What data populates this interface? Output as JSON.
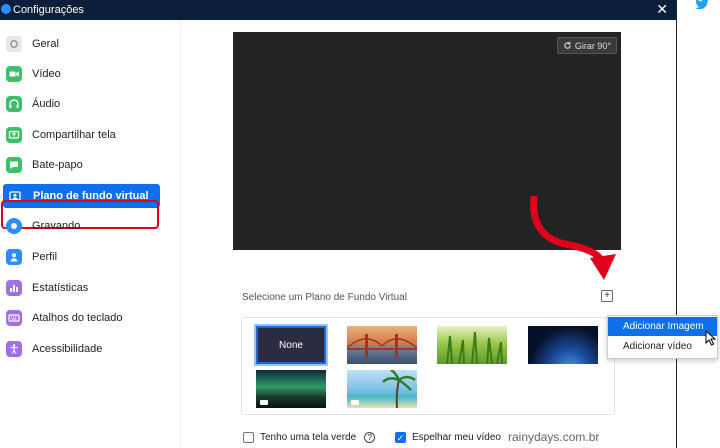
{
  "window": {
    "title": "Configurações",
    "close_glyph": "✕"
  },
  "right_pane": {
    "icon": "twitter-icon",
    "glyph": "🐦"
  },
  "sidebar": {
    "items": [
      {
        "label": "Geral",
        "icon": "gear-icon",
        "color": "#d0d0d0"
      },
      {
        "label": "Vídeo",
        "icon": "video-icon",
        "color": "#3cc06a"
      },
      {
        "label": "Áudio",
        "icon": "headphones-icon",
        "color": "#3cc06a"
      },
      {
        "label": "Compartilhar tela",
        "icon": "share-screen-icon",
        "color": "#3cc06a"
      },
      {
        "label": "Bate-papo",
        "icon": "chat-icon",
        "color": "#3cc06a"
      },
      {
        "label": "Plano de fundo virtual",
        "icon": "virtual-background-icon",
        "color": "#ffffff"
      },
      {
        "label": "Gravando",
        "icon": "record-icon",
        "color": "#2d8cff"
      },
      {
        "label": "Perfil",
        "icon": "profile-icon",
        "color": "#2d8cff"
      },
      {
        "label": "Estatísticas",
        "icon": "statistics-icon",
        "color": "#a070e0"
      },
      {
        "label": "Atalhos do teclado",
        "icon": "keyboard-icon",
        "color": "#a070e0"
      },
      {
        "label": "Acessibilidade",
        "icon": "accessibility-icon",
        "color": "#a070e0"
      }
    ],
    "active_index": 5
  },
  "preview": {
    "rotate_label": "Girar 90°"
  },
  "background_section": {
    "label": "Selecione um Plano de Fundo Virtual",
    "add_glyph": "+",
    "none_label": "None",
    "thumbnails": [
      "none",
      "golden-gate",
      "grass",
      "earth-space",
      "aurora",
      "beach"
    ]
  },
  "dropdown": {
    "items": [
      "Adicionar Imagem",
      "Adicionar vídeo"
    ],
    "highlighted_index": 0
  },
  "footer": {
    "green_screen_label": "Tenho uma tela verde",
    "green_screen_checked": false,
    "help_glyph": "?",
    "mirror_label": "Espelhar meu vídeo",
    "mirror_checked": true
  },
  "watermark": "rainydays.com.br",
  "colors": {
    "accent": "#0e71eb",
    "annotation_red": "#e0001b",
    "titlebar": "#0b1f3a"
  }
}
